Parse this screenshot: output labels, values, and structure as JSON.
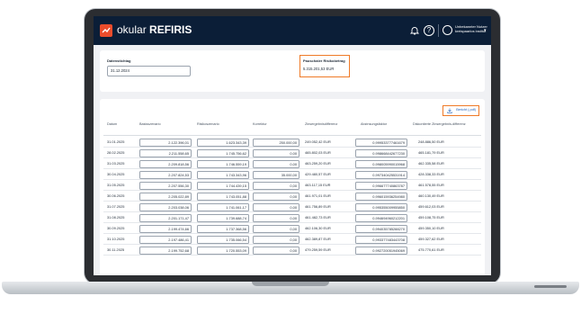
{
  "app": {
    "brand_prefix": "okular",
    "brand_name": "REFIRIS"
  },
  "user": {
    "line1": "Unbekannter Nutzer",
    "line2": "kreispaarlos institut"
  },
  "stichtag": {
    "label": "Datenstichtag",
    "value": "31.12.2024"
  },
  "pauschal": {
    "label": "Pauschaler Risikobetrag",
    "value": "5.315.201,53 EUR"
  },
  "report_button": "Bericht (.pdf)",
  "columns": [
    "Datum",
    "Basisszenario",
    "Risikoszenario",
    "Korrektur",
    "Zinsergebnisdifferenz",
    "Abzinsungsfaktor",
    "Diskontierte Zinsergebnis-differenz"
  ],
  "rows": [
    {
      "datum": "31.01.2025",
      "basis": "2.122.396,01",
      "risiko": "1.623.343,39",
      "korrektur": "250.000,00",
      "zins": "249.052,42 EUR",
      "faktor": "0,999533777461679",
      "disk": "248.886,50 EUR"
    },
    {
      "datum": "28.02.2025",
      "basis": "2.211.558,65",
      "risiko": "1.745.756,62",
      "korrektur": "0,00",
      "zins": "465.802,03 EUR",
      "faktor": "0,998668442677230",
      "disk": "465.181,79 EUR"
    },
    {
      "datum": "31.03.2025",
      "basis": "2.209.818,56",
      "risiko": "1.746.559,19",
      "korrektur": "0,00",
      "zins": "463.259,20 EUR",
      "faktor": "0,998005990015968",
      "disk": "462.335,58 EUR"
    },
    {
      "datum": "30.04.2025",
      "basis": "2.207.824,53",
      "risiko": "1.743.343,96",
      "korrektur": "35.000,00",
      "zins": "429.480,57 EUR",
      "faktor": "0,997340425531914",
      "disk": "428.338,33 EUR"
    },
    {
      "datum": "31.05.2025",
      "basis": "2.207.556,30",
      "risiko": "1.744.439,15",
      "korrektur": "0,00",
      "zins": "463.117,15 EUR",
      "faktor": "0,996677740863787",
      "disk": "461.578,55 EUR"
    },
    {
      "datum": "30.06.2025",
      "basis": "2.205.022,89",
      "risiko": "1.743.051,88",
      "korrektur": "0,00",
      "zins": "461.971,01 EUR",
      "faktor": "0,996015936254980",
      "disk": "460.130,49 EUR"
    },
    {
      "datum": "31.07.2025",
      "basis": "2.203.038,06",
      "risiko": "1.741.061,17",
      "korrektur": "0,00",
      "zins": "461.756,89 EUR",
      "faktor": "0,995355009955850",
      "disk": "459.612,03 EUR"
    },
    {
      "datum": "31.08.2025",
      "basis": "2.201.171,47",
      "risiko": "1.739.688,74",
      "korrektur": "0,00",
      "zins": "461.482,73 EUR",
      "faktor": "0,994694960212201",
      "disk": "459.108,75 EUR"
    },
    {
      "datum": "30.09.2025",
      "basis": "2.199.474,66",
      "risiko": "1.737.368,56",
      "korrektur": "0,00",
      "zins": "462.106,30 EUR",
      "faktor": "0,994035785288270",
      "disk": "459.350,10 EUR"
    },
    {
      "datum": "31.10.2025",
      "basis": "2.197.486,41",
      "risiko": "1.735.066,54",
      "korrektur": "0,00",
      "zins": "462.389,87 EUR",
      "faktor": "0,993377483443708",
      "disk": "459.327,62 EUR"
    },
    {
      "datum": "30.11.2025",
      "basis": "2.199.752,68",
      "risiko": "1.720.553,09",
      "korrektur": "0,00",
      "zins": "479.259,59 EUR",
      "faktor": "0,992720051945069",
      "disk": "475.770,61 EUR"
    }
  ]
}
